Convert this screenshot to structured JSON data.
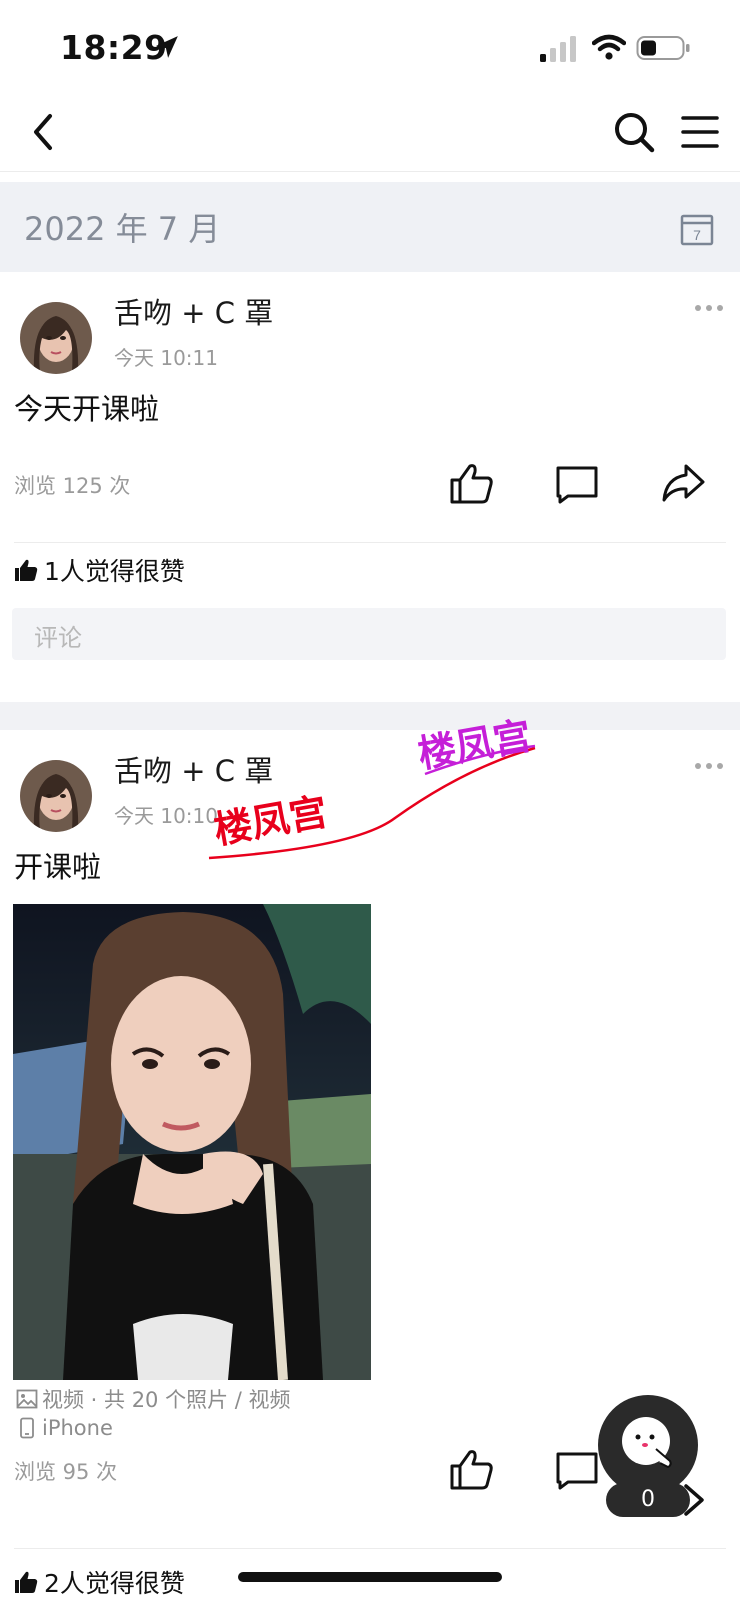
{
  "status_bar": {
    "time": "18:29"
  },
  "date_header": {
    "title": "2022 年 7 月",
    "calendar_day": "7"
  },
  "posts": [
    {
      "author": "舌吻 + C 罩",
      "time": "今天 10:11",
      "text": "今天开课啦",
      "views": "浏览 125 次",
      "likes": "1人觉得很赞",
      "comment_placeholder": "评论"
    },
    {
      "author": "舌吻 + C 罩",
      "time": "今天 10:10",
      "text": "开课啦",
      "media_info": "视频 · 共 20 个照片 / 视频",
      "device": "iPhone",
      "views": "浏览 95 次",
      "likes": "2人觉得很赞"
    }
  ],
  "watermark": {
    "text_1": "楼凤宫",
    "text_2": "楼凤宫"
  },
  "floating": {
    "badge_count": "0"
  },
  "colors": {
    "date_bg": "#eff1f5",
    "muted": "#9a9a9a",
    "watermark_red": "#e8001c",
    "watermark_purple": "#c51fd8"
  }
}
